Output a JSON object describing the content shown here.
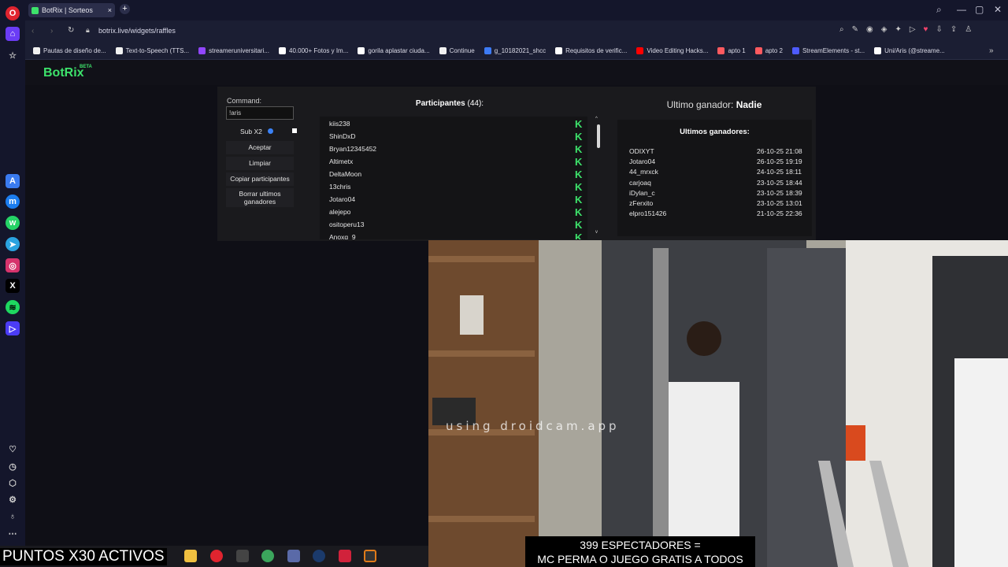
{
  "browser": {
    "tab_title": "BotRix | Sorteos",
    "url": "botrix.live/widgets/raffles",
    "new_tab": "+",
    "bookmarks": [
      {
        "label": "Pautas de diseño de...",
        "color": "#f1f1f1"
      },
      {
        "label": "Text-to-Speech (TTS...",
        "color": "#f1f1f1"
      },
      {
        "label": "streameruniversitari...",
        "color": "#9146ff"
      },
      {
        "label": "40.000+ Fotos y Im...",
        "color": "#ffffff"
      },
      {
        "label": "gorila aplastar ciuda...",
        "color": "#ffffff"
      },
      {
        "label": "Continue",
        "color": "#f1f1f1"
      },
      {
        "label": "g_10182021_shcc",
        "color": "#3d7bf5"
      },
      {
        "label": "Requisitos de verific...",
        "color": "#ffffff"
      },
      {
        "label": "Video Editing Hacks...",
        "color": "#ff0000"
      },
      {
        "label": "apto 1",
        "color": "#ff5a5f"
      },
      {
        "label": "apto 2",
        "color": "#ff5a5f"
      },
      {
        "label": "StreamElements - st...",
        "color": "#4e5bff"
      },
      {
        "label": "Uni/Aris (@streame...",
        "color": "#ffffff"
      }
    ]
  },
  "botrix": {
    "logo": "BotRix",
    "beta": "BETA",
    "command_label": "Command:",
    "command_value": "!aris",
    "sub_label": "Sub X2",
    "buttons": {
      "accept": "Aceptar",
      "clear": "Limpiar",
      "copy": "Copiar participantes",
      "delete": "Borrar ultimos ganadores"
    },
    "participants_title": "Participantes",
    "participants_count": "(44):",
    "participants": [
      "kiis238",
      "ShinDxD",
      "Bryan12345452",
      "Altimetx",
      "DeltaMoon",
      "13chris",
      "Jotaro04",
      "alejepo",
      "ositoperu13",
      "Anoxq_9"
    ],
    "last_winner_label": "Ultimo ganador:",
    "last_winner_value": "Nadie",
    "winners_title": "Ultimos ganadores:",
    "winners": [
      {
        "name": "ODIXYT",
        "date": "26-10-25 21:08"
      },
      {
        "name": "Jotaro04",
        "date": "26-10-25 19:19"
      },
      {
        "name": "44_mrxck",
        "date": "24-10-25 18:11"
      },
      {
        "name": "carjoaq",
        "date": "23-10-25 18:44"
      },
      {
        "name": "iDylan_c",
        "date": "23-10-25 18:39"
      },
      {
        "name": "zFerxito",
        "date": "23-10-25 13:01"
      },
      {
        "name": "elpro151426",
        "date": "21-10-25 22:36"
      }
    ]
  },
  "stream": {
    "watermark": "using droidcam.app",
    "viewers_line1": "399 ESPECTADORES =",
    "viewers_line2": "MC PERMA O JUEGO GRATIS A TODOS",
    "puntos": "PUNTOS X30 ACTIVOS"
  }
}
